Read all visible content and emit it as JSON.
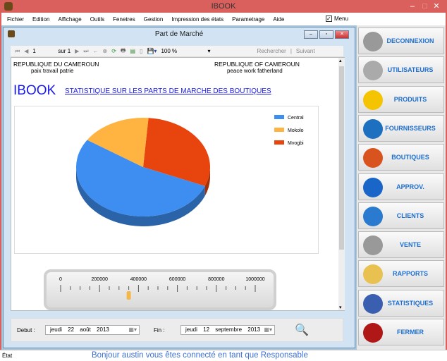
{
  "app": {
    "title": "IBOOK"
  },
  "menu": {
    "items": [
      "Fichier",
      "Edition",
      "Affichage",
      "Outils",
      "Fenetres",
      "Gestion",
      "Impression des états",
      "Parametrage",
      "Aide"
    ],
    "menu_checkbox": "Menu",
    "menu_checked": true
  },
  "child": {
    "title": "Part de Marché"
  },
  "toolbar": {
    "page": "1",
    "of": "sur 1",
    "zoom": "100 %",
    "search": "Rechercher",
    "next": "Suivant"
  },
  "report": {
    "left_header": "REPUBLIQUE DU CAMEROUN",
    "left_motto": "paix travail patrie",
    "right_header": "REPUBLIQUE OF CAMEROUN",
    "right_motto": "peace work fatherland",
    "brand": "IBOOK",
    "subtitle": "STATISTIQUE SUR LES PARTS DE MARCHE DES BOUTIQUES"
  },
  "chart_data": {
    "type": "pie",
    "categories": [
      "Central",
      "Mokolo",
      "Mvogbi"
    ],
    "values": [
      53,
      17,
      30
    ],
    "colors": [
      "#3d8ef0",
      "#ffb340",
      "#e8450e"
    ],
    "legend": "right"
  },
  "gauge": {
    "ticks": [
      "0",
      "200000",
      "400000",
      "600000",
      "800000",
      "1000000"
    ],
    "min": 0,
    "max": 1000000,
    "value": 350000
  },
  "filter": {
    "debut_label": "Debut :",
    "debut_value": "jeudi 22 août 2013",
    "fin_label": "Fin :",
    "fin_value": "jeudi 12 septembre 2013"
  },
  "sidebar": {
    "items": [
      "DECONNEXION",
      "UTILISATEURS",
      "PRODUITS",
      "FOURNISSEURS",
      "BOUTIQUES",
      "APPROV.",
      "CLIENTS",
      "VENTE",
      "RAPPORTS",
      "STATISTIQUES",
      "FERMER"
    ]
  },
  "status": {
    "state": "État",
    "message": "Bonjour austin vous êtes connecté en tant que Responsable"
  }
}
